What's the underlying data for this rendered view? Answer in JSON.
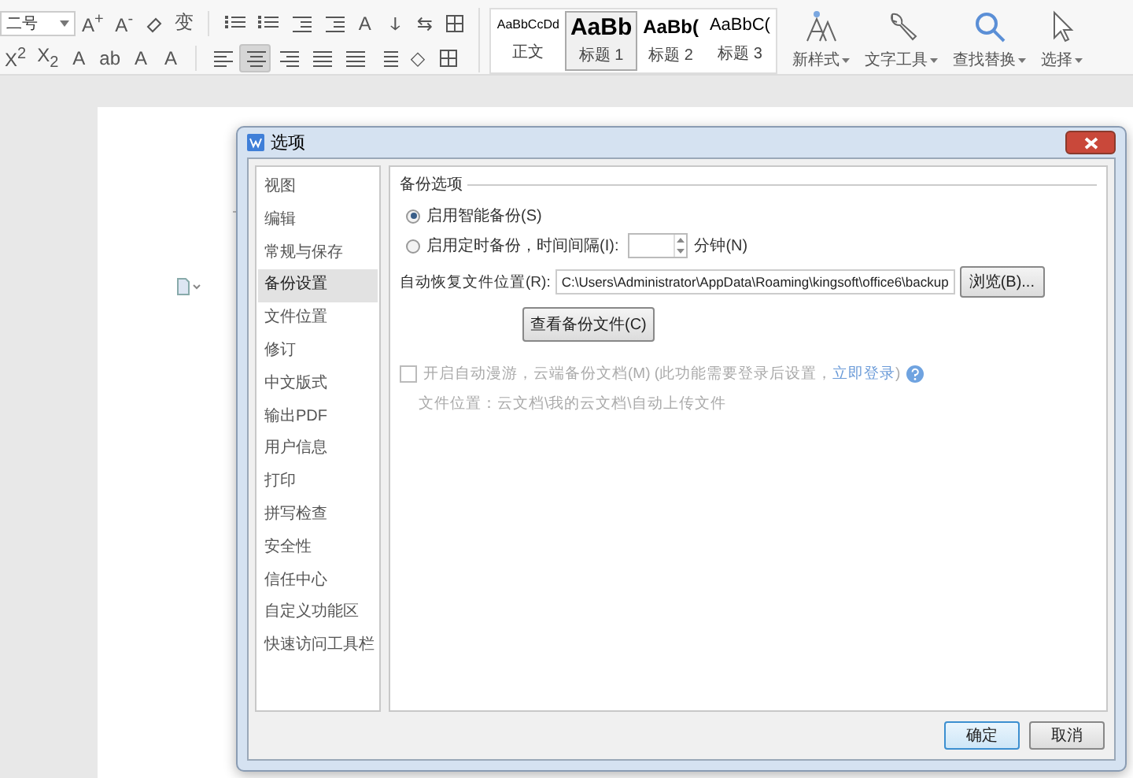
{
  "toolbar": {
    "font_size": "二号",
    "row1": [
      {
        "kind": "glyph",
        "text": "A$^{+}$"
      },
      {
        "kind": "glyph",
        "text": "A$^{-}$"
      },
      {
        "kind": "eraser"
      },
      {
        "kind": "glyph",
        "text": "变"
      },
      {
        "kind": "sep"
      },
      {
        "kind": "bullets"
      },
      {
        "kind": "numbered"
      },
      {
        "kind": "indent-dec"
      },
      {
        "kind": "indent-inc"
      },
      {
        "kind": "glyph",
        "text": "A"
      },
      {
        "kind": "glyph",
        "text": "ↆ"
      },
      {
        "kind": "glyph",
        "text": "⇆"
      },
      {
        "kind": "border"
      }
    ],
    "row2": [
      {
        "kind": "glyph",
        "text": "X$^{2}$"
      },
      {
        "kind": "glyph",
        "text": "X$_{2}$"
      },
      {
        "kind": "glyph",
        "text": "A"
      },
      {
        "kind": "glyph",
        "text": "ab"
      },
      {
        "kind": "glyph",
        "text": "A"
      },
      {
        "kind": "glyph",
        "text": "A"
      },
      {
        "kind": "sep"
      },
      {
        "kind": "align-left",
        "selected": false
      },
      {
        "kind": "align-center",
        "selected": true
      },
      {
        "kind": "align-right",
        "selected": false
      },
      {
        "kind": "justify",
        "selected": false
      },
      {
        "kind": "distribute",
        "selected": false
      },
      {
        "kind": "spacing"
      },
      {
        "kind": "glyph",
        "text": "◇"
      },
      {
        "kind": "border"
      }
    ],
    "styles": [
      {
        "sample": "AaBbCcDd",
        "label": "正文",
        "selected": false
      },
      {
        "sample": "AaBb",
        "label": "标题 1",
        "selected": true
      },
      {
        "sample": "AaBb(",
        "label": "标题 2",
        "selected": false
      },
      {
        "sample": "AaBbC(",
        "label": "标题 3",
        "selected": false
      }
    ],
    "tools": [
      {
        "kind": "new-style",
        "label": "新样式"
      },
      {
        "kind": "wrench",
        "label": "文字工具"
      },
      {
        "kind": "search",
        "label": "查找替换"
      },
      {
        "kind": "pointer",
        "label": "选择"
      }
    ]
  },
  "dialog": {
    "title": "选项",
    "sidebar": [
      {
        "label": "视图",
        "selected": false
      },
      {
        "label": "编辑",
        "selected": false
      },
      {
        "label": "常规与保存",
        "selected": false
      },
      {
        "label": "备份设置",
        "selected": true
      },
      {
        "label": "文件位置",
        "selected": false
      },
      {
        "label": "修订",
        "selected": false
      },
      {
        "label": "中文版式",
        "selected": false
      },
      {
        "label": "输出PDF",
        "selected": false
      },
      {
        "label": "用户信息",
        "selected": false
      },
      {
        "label": "打印",
        "selected": false
      },
      {
        "label": "拼写检查",
        "selected": false
      },
      {
        "label": "安全性",
        "selected": false
      },
      {
        "label": "信任中心",
        "selected": false
      },
      {
        "label": "自定义功能区",
        "selected": false
      },
      {
        "label": "快速访问工具栏",
        "selected": false
      }
    ],
    "section_title": "备份选项",
    "radios": [
      {
        "label": "启用智能备份(S)",
        "selected": true
      },
      {
        "label": "启用定时备份，时间间隔(I):",
        "selected": false
      }
    ],
    "interval_unit": "分钟(N)",
    "path_label": "自动恢复文件位置(R):",
    "path_value": "C:\\Users\\Administrator\\AppData\\Roaming\\kingsoft\\office6\\backup",
    "browse_button": "浏览(B)...",
    "view_button": "查看备份文件(C)",
    "roaming": {
      "checked": false,
      "disabled": true,
      "label": "开启自动漫游，云端备份文档(M)",
      "note": "(此功能需要登录后设置，",
      "link": "立即登录",
      "note_end": ")"
    },
    "file_location": "文件位置：云文档\\我的云文档\\自动上传文件",
    "buttons": [
      {
        "label": "确定",
        "selected": true
      },
      {
        "label": "取消",
        "selected": false
      }
    ]
  }
}
